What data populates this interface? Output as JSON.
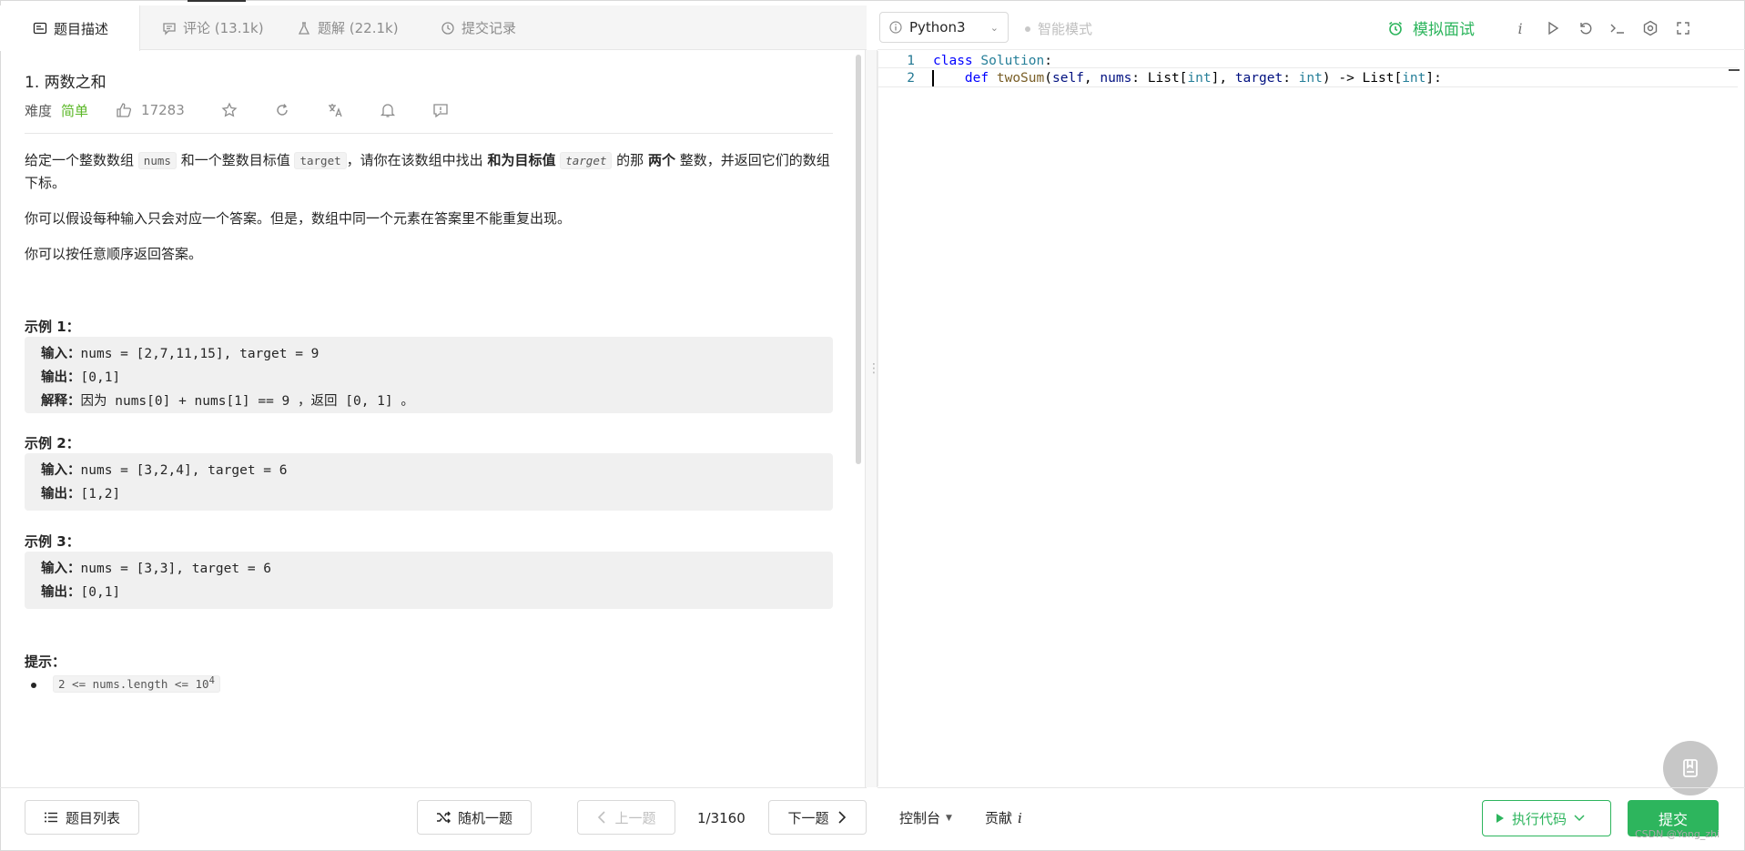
{
  "left_tabs": [
    {
      "label": "题目描述",
      "icon": "description-icon"
    },
    {
      "label": "评论 (13.1k)",
      "icon": "comment-icon"
    },
    {
      "label": "题解 (22.1k)",
      "icon": "flask-icon"
    },
    {
      "label": "提交记录",
      "icon": "history-icon"
    }
  ],
  "problem": {
    "title": "1. 两数之和",
    "difficulty_label": "难度",
    "difficulty": "简单",
    "likes": "17283",
    "desc": {
      "p1_a": "给定一个整数数组",
      "p1_nums": "nums",
      "p1_b": "和一个整数目标值",
      "p1_target": "target",
      "p1_c": "，请你在该数组中找出",
      "p1_bold": "和为目标值",
      "p1_target2": "target",
      "p1_d": "的那",
      "p1_bold2": "两个",
      "p1_e": "整数，并返回它们的数组下标。",
      "p2": "你可以假设每种输入只会对应一个答案。但是，数组中同一个元素在答案里不能重复出现。",
      "p3": "你可以按任意顺序返回答案。"
    },
    "examples": [
      {
        "title": "示例 1：",
        "lines": [
          {
            "k": "输入：",
            "v": "nums = [2,7,11,15], target = 9"
          },
          {
            "k": "输出：",
            "v": "[0,1]"
          },
          {
            "k": "解释：",
            "v": "因为 nums[0] + nums[1] == 9 ，返回 [0, 1] 。"
          }
        ]
      },
      {
        "title": "示例 2：",
        "lines": [
          {
            "k": "输入：",
            "v": "nums = [3,2,4], target = 6"
          },
          {
            "k": "输出：",
            "v": "[1,2]"
          }
        ]
      },
      {
        "title": "示例 3：",
        "lines": [
          {
            "k": "输入：",
            "v": "nums = [3,3], target = 6"
          },
          {
            "k": "输出：",
            "v": "[0,1]"
          }
        ]
      }
    ],
    "hint_title": "提示：",
    "hint_item": "2 <= nums.length <= 10",
    "hint_sup": "4"
  },
  "left_footer": {
    "list": "题目列表",
    "random": "随机一题",
    "prev": "上一题",
    "pager": "1/3160",
    "next": "下一题"
  },
  "editor_toolbar": {
    "language": "Python3",
    "smart_mode": "智能模式",
    "interview": "模拟面试",
    "info_icon_label": "i"
  },
  "code": {
    "line1_no": "1",
    "line2_no": "2",
    "l1_kw": "class",
    "l1_cls": "Solution",
    "l1_end": ":",
    "l2_indent": "    ",
    "l2_def": "def",
    "l2_fn": "twoSum",
    "l2_p1": "(",
    "l2_self": "self",
    "l2_c1": ", ",
    "l2_nums": "nums",
    "l2_c2": ": List[",
    "l2_int1": "int",
    "l2_c3": "], ",
    "l2_target": "target",
    "l2_c4": ": ",
    "l2_int2": "int",
    "l2_c5": ") -> List[",
    "l2_int3": "int",
    "l2_c6": "]:"
  },
  "right_footer": {
    "console": "控制台",
    "contribute": "贡献",
    "contribute_i": "i",
    "run": "执行代码",
    "submit": "提交"
  },
  "watermark": "CSDN @Yong_zhi",
  "colors": {
    "accent_green": "#2db55d",
    "easy_green": "#5ab726"
  }
}
